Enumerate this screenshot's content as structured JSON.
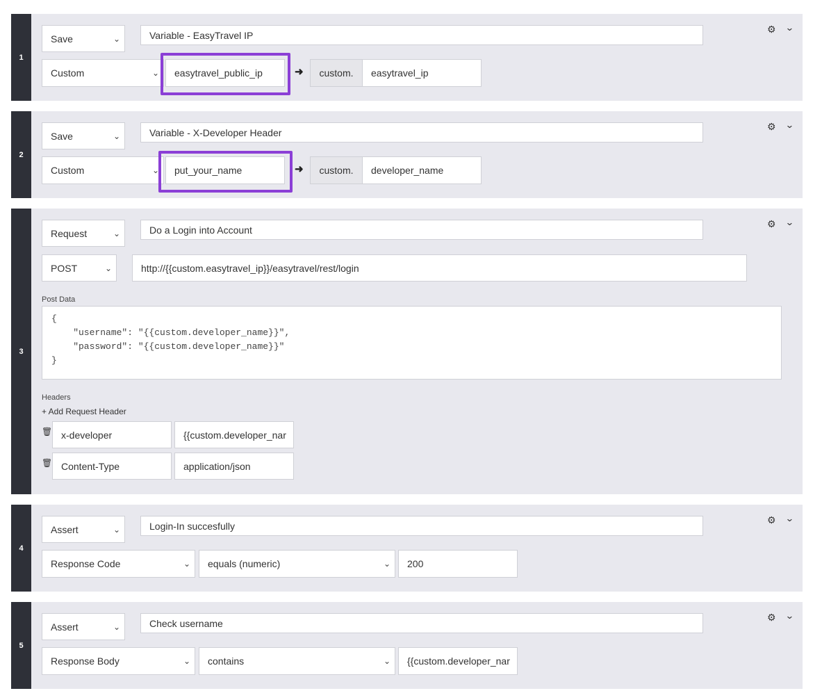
{
  "steps": [
    {
      "number": "1",
      "type": "Save",
      "description": "Variable - EasyTravel IP",
      "source": "Custom",
      "value": "easytravel_public_ip",
      "prefix": "custom.",
      "variable": "easytravel_ip"
    },
    {
      "number": "2",
      "type": "Save",
      "description": "Variable - X-Developer Header",
      "source": "Custom",
      "value": "put_your_name",
      "prefix": "custom.",
      "variable": "developer_name"
    },
    {
      "number": "3",
      "type": "Request",
      "description": "Do a Login into Account",
      "method": "POST",
      "url": "http://{{custom.easytravel_ip}}/easytravel/rest/login",
      "post_data_label": "Post Data",
      "post_data": "{\n    \"username\": \"{{custom.developer_name}}\",\n    \"password\": \"{{custom.developer_name}}\"\n}",
      "headers_label": "Headers",
      "add_header_label": "+ Add Request Header",
      "headers": [
        {
          "name": "x-developer",
          "value": "{{custom.developer_nar"
        },
        {
          "name": "Content-Type",
          "value": "application/json"
        }
      ]
    },
    {
      "number": "4",
      "type": "Assert",
      "description": "Login-In succesfully",
      "target": "Response Code",
      "operator": "equals (numeric)",
      "expected": "200"
    },
    {
      "number": "5",
      "type": "Assert",
      "description": "Check username",
      "target": "Response Body",
      "operator": "contains",
      "expected": "{{custom.developer_nar"
    }
  ],
  "icons": {
    "settings": "gear-icon",
    "collapse": "chevron-down-icon",
    "arrow": "arrow-right-icon",
    "delete": "trash-icon"
  },
  "colors": {
    "highlight": "#8b3fd6",
    "step_bar": "#2e3038",
    "panel": "#e8e8ee"
  }
}
